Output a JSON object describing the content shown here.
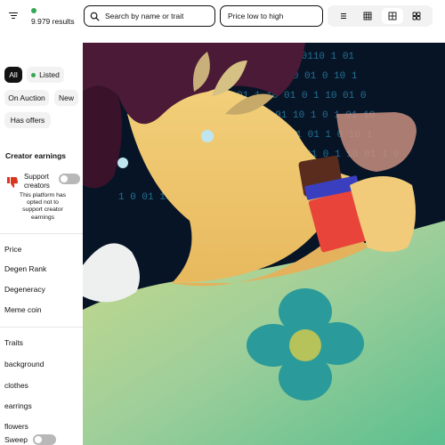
{
  "toolbar": {
    "results_count": "9.979 results",
    "search_placeholder": "Search by name or trait",
    "sort_label": "Price low to high",
    "view_modes": [
      "list-view-icon",
      "small-grid-icon",
      "medium-grid-icon",
      "large-grid-icon"
    ],
    "active_view": "medium-grid-icon"
  },
  "sidebar": {
    "status_chips": [
      "All",
      "Listed",
      "On Auction",
      "New",
      "Has offers"
    ],
    "active_chip": "All",
    "creator_earnings": {
      "title": "Creator earnings",
      "support_label": "Support creators",
      "note": "This platform has opted not to support creator earnings",
      "toggle_on": false
    },
    "filters": [
      "Price",
      "Degen Rank",
      "Degeneracy",
      "Meme coin"
    ],
    "traits_title": "Traits",
    "traits": [
      "background",
      "clothes",
      "earrings",
      "flowers"
    ],
    "sweep_label": "Sweep"
  },
  "colors": {
    "accent_green": "#34a853",
    "dark": "#121212",
    "chip_bg": "#f2f2f2",
    "toggle_off": "#b8b8b8"
  }
}
